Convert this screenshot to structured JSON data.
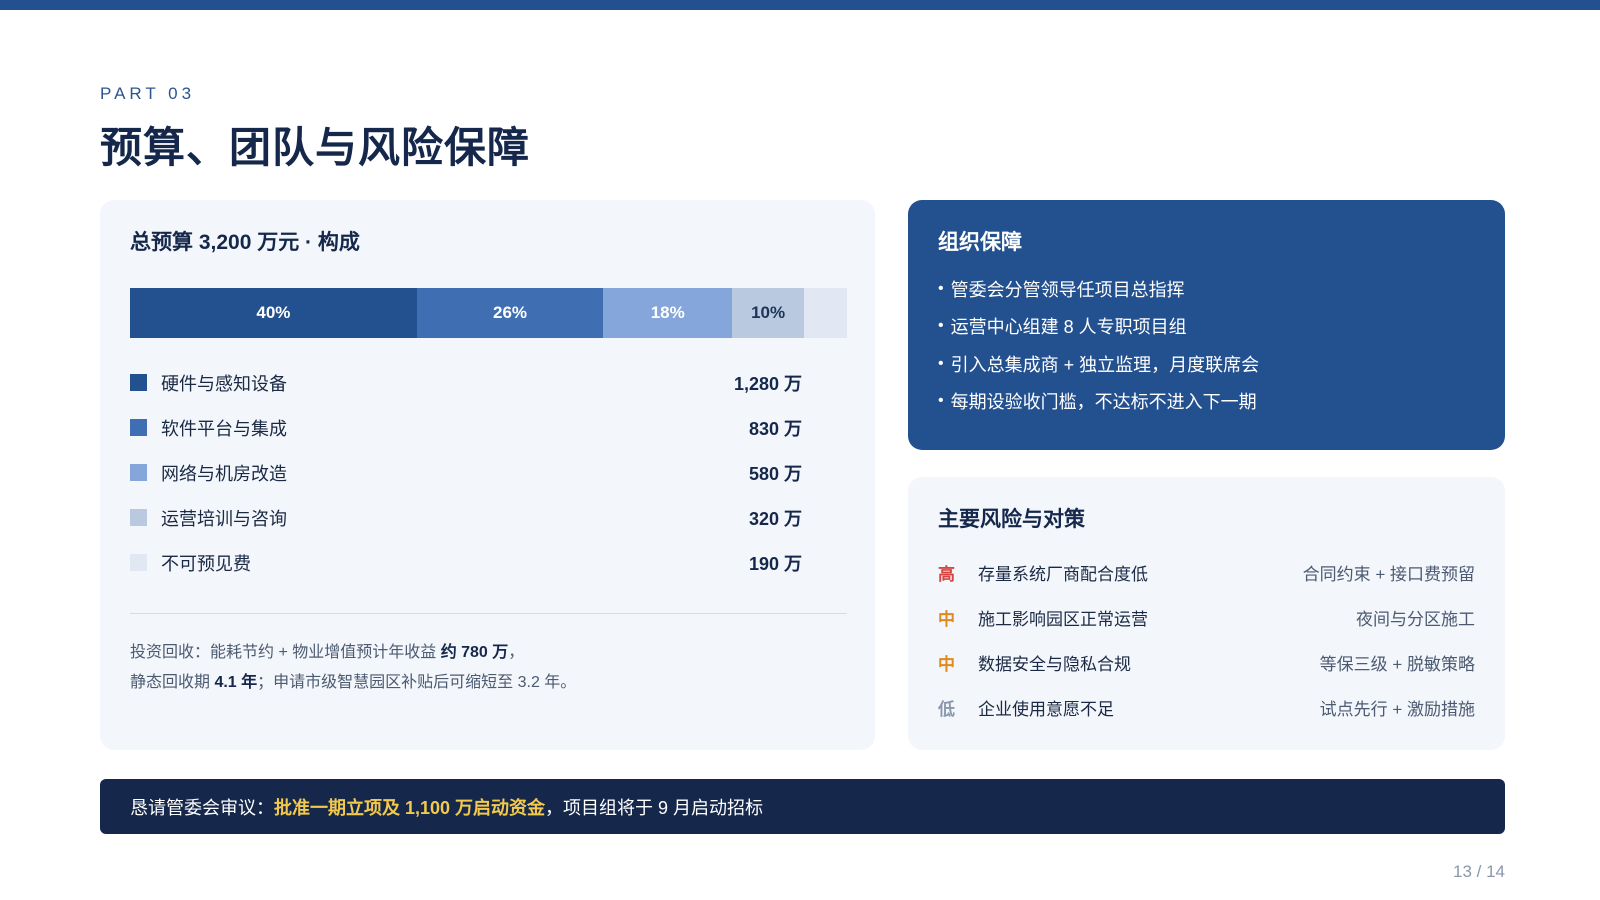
{
  "header": {
    "part_label": "PART 03",
    "title": "预算、团队与风险保障"
  },
  "budget": {
    "title": "总预算 3,200 万元 · 构成",
    "segments": [
      {
        "label": "40%",
        "share": 40,
        "color": "#23508f"
      },
      {
        "label": "26%",
        "share": 26,
        "color": "#3f6eb2"
      },
      {
        "label": "18%",
        "share": 18,
        "color": "#84a6da"
      },
      {
        "label": "10%",
        "share": 10,
        "color": "#b9c9e0"
      },
      {
        "label": "",
        "share": 6,
        "color": "#e1e8f3"
      }
    ],
    "items": [
      {
        "label": "硬件与感知设备",
        "value": "1,280 万",
        "color": "#23508f"
      },
      {
        "label": "软件平台与集成",
        "value": "830 万",
        "color": "#3f6eb2"
      },
      {
        "label": "网络与机房改造",
        "value": "580 万",
        "color": "#84a6da"
      },
      {
        "label": "运营培训与咨询",
        "value": "320 万",
        "color": "#b9c9e0"
      },
      {
        "label": "不可预见费",
        "value": "190 万",
        "color": "#e1e8f3"
      }
    ],
    "roi": {
      "line1_a": "投资回收：能耗节约 + 物业增值预计年收益 ",
      "line1_b": "约 780 万",
      "line1_c": "，",
      "line2_a": "静态回收期 ",
      "line2_b": "4.1 年",
      "line2_c": "；申请市级智慧园区补贴后可缩短至 3.2 年。"
    }
  },
  "org": {
    "title": "组织保障",
    "items": [
      "管委会分管领导任项目总指挥",
      "运营中心组建 8 人专职项目组",
      "引入总集成商 + 独立监理，月度联席会",
      "每期设验收门槛，不达标不进入下一期"
    ]
  },
  "risks": {
    "title": "主要风险与对策",
    "items": [
      {
        "level": "高",
        "level_color": "#d64541",
        "name": "存量系统厂商配合度低",
        "measure": "合同约束 + 接口费预留"
      },
      {
        "level": "中",
        "level_color": "#e08a1e",
        "name": "施工影响园区正常运营",
        "measure": "夜间与分区施工"
      },
      {
        "level": "中",
        "level_color": "#e08a1e",
        "name": "数据安全与隐私合规",
        "measure": "等保三级 + 脱敏策略"
      },
      {
        "level": "低",
        "level_color": "#8a97ac",
        "name": "企业使用意愿不足",
        "measure": "试点先行 + 激励措施"
      }
    ]
  },
  "ask": {
    "prefix": "恳请管委会审议：",
    "highlight": "批准一期立项及 1,100 万启动资金",
    "suffix": "，项目组将于 9 月启动招标"
  },
  "page_number": "13 / 14"
}
